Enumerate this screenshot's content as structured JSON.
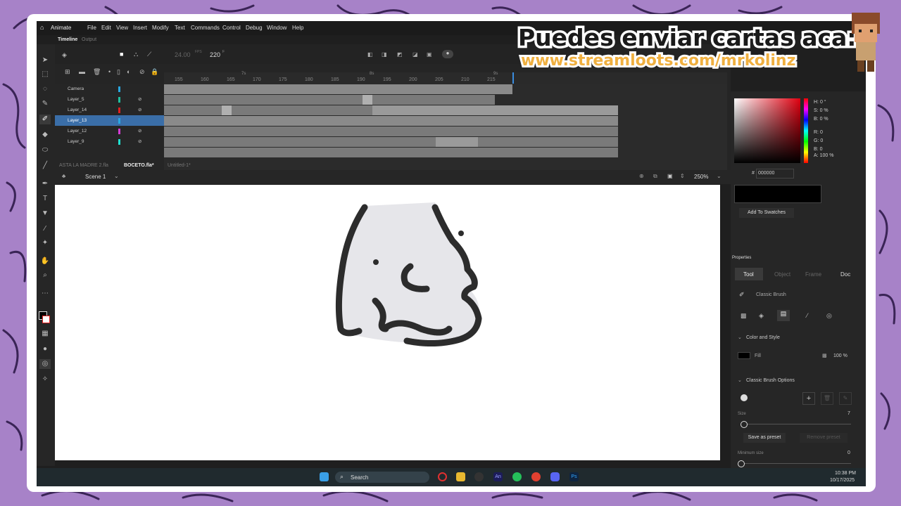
{
  "overlay": {
    "banner_line1": "Puedes enviar cartas aca:",
    "banner_line2": "www.streamloots.com/mrkolinz",
    "background_color": "#a782c8"
  },
  "app": {
    "name": "Animate",
    "menu": [
      "File",
      "Edit",
      "View",
      "Insert",
      "Modify",
      "Text",
      "Commands",
      "Control",
      "Debug",
      "Window",
      "Help"
    ],
    "panel_tabs": [
      "Timeline",
      "Output"
    ]
  },
  "timeline": {
    "fps": "24.00",
    "fps_unit": "FPS",
    "frame": "220",
    "frame_unit": "F",
    "ruler_marks": [
      "155",
      "160",
      "165",
      "170",
      "175",
      "180",
      "185",
      "190",
      "195",
      "200",
      "205",
      "210",
      "215"
    ],
    "ruler_sec_marks": [
      "7s",
      "8s",
      "9s"
    ],
    "layers": [
      {
        "name": "Camera",
        "color": "#2aa7e0"
      },
      {
        "name": "Layer_5",
        "color": "#1fbfa0"
      },
      {
        "name": "Layer_14",
        "color": "#e02020"
      },
      {
        "name": "Layer_13",
        "color": "#2aa7e0"
      },
      {
        "name": "Layer_12",
        "color": "#d43bd4"
      },
      {
        "name": "Layer_9",
        "color": "#1fe0d0"
      }
    ]
  },
  "documents": {
    "tabs": [
      "ASTA LA MADRE 2.fla",
      "BOCETO.fla*",
      "Untitled-1*"
    ],
    "active": "BOCETO.fla*",
    "scene": "Scene 1",
    "zoom": "250%"
  },
  "color_panel": {
    "h_label": "H:",
    "h": "0 °",
    "s_label": "S:",
    "s": "0 %",
    "b_label": "B:",
    "b": "0 %",
    "r_label": "R:",
    "r": "0",
    "g_label": "G:",
    "g": "0",
    "bb_label": "B:",
    "bb": "0",
    "a_label": "A:",
    "a": "100 %",
    "hex_label": "#",
    "hex": "000000",
    "add_swatches": "Add To Swatches"
  },
  "properties": {
    "title": "Properties",
    "tabs": [
      "Tool",
      "Object",
      "Frame",
      "Doc"
    ],
    "tool_name": "Classic Brush",
    "color_and_style": "Color and Style",
    "fill_label": "Fill",
    "fill_alpha": "100 %",
    "brush_options": "Classic Brush Options",
    "size_label": "Size",
    "size_value": "7",
    "save_preset": "Save as preset",
    "remove_preset": "Remove preset",
    "min_size_label": "Minimum size",
    "min_size_value": "0"
  },
  "taskbar": {
    "search": "Search",
    "time": "10:38 PM",
    "date": "10/17/2025"
  }
}
